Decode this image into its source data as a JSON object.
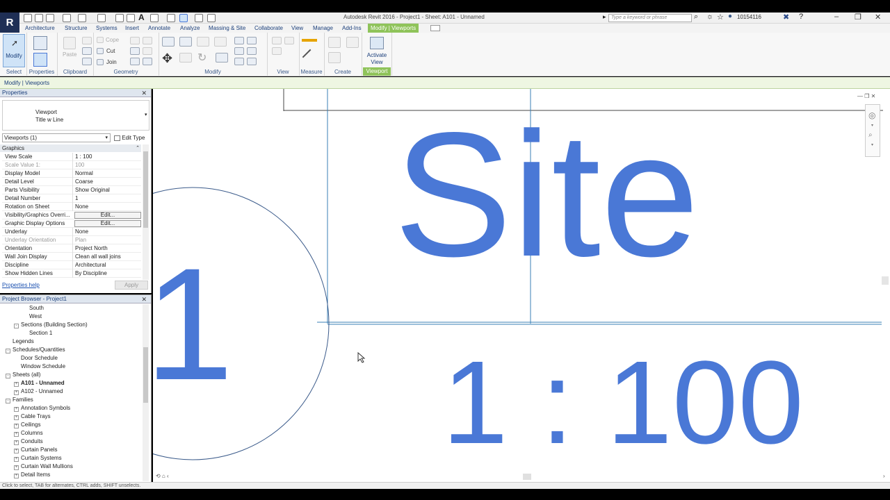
{
  "app": {
    "logo": "R",
    "title": "Autodesk Revit 2016 -    Project1 - Sheet: A101 - Unnamed",
    "search_placeholder": "Type a keyword or phrase",
    "user": "10154116"
  },
  "tabs": [
    "Architecture",
    "Structure",
    "Systems",
    "Insert",
    "Annotate",
    "Analyze",
    "Massing & Site",
    "Collaborate",
    "View",
    "Manage",
    "Add-Ins",
    "Modify | Viewports"
  ],
  "ribbon": {
    "modify_label": "Modify",
    "select_label": "Select",
    "properties_label": "Properties",
    "clipboard_label": "Clipboard",
    "paste_label": "Paste",
    "cope_label": "Cope",
    "cut_label": "Cut",
    "join_label": "Join",
    "geometry_label": "Geometry",
    "modify_panel_label": "Modify",
    "view_label": "View",
    "measure_label": "Measure",
    "create_label": "Create",
    "activate_view_label": "Activate View",
    "viewport_label": "Viewport"
  },
  "context_bar": "Modify | Viewports",
  "properties": {
    "title": "Properties",
    "type_name": "Viewport",
    "type_sub": "Title w Line",
    "selector": "Viewports (1)",
    "edit_type": "Edit Type",
    "section": "Graphics",
    "rows": [
      {
        "k": "View Scale",
        "v": "1 : 100"
      },
      {
        "k": "Scale Value    1:",
        "v": "100"
      },
      {
        "k": "Display Model",
        "v": "Normal"
      },
      {
        "k": "Detail Level",
        "v": "Coarse"
      },
      {
        "k": "Parts Visibility",
        "v": "Show Original"
      },
      {
        "k": "Detail Number",
        "v": "1"
      },
      {
        "k": "Rotation on Sheet",
        "v": "None"
      },
      {
        "k": "Visibility/Graphics Overri...",
        "v": "Edit..."
      },
      {
        "k": "Graphic Display Options",
        "v": "Edit..."
      },
      {
        "k": "Underlay",
        "v": "None"
      },
      {
        "k": "Underlay Orientation",
        "v": "Plan"
      },
      {
        "k": "Orientation",
        "v": "Project North"
      },
      {
        "k": "Wall Join Display",
        "v": "Clean all wall joins"
      },
      {
        "k": "Discipline",
        "v": "Architectural"
      },
      {
        "k": "Show Hidden Lines",
        "v": "By Discipline"
      }
    ],
    "help": "Properties help",
    "apply": "Apply"
  },
  "browser": {
    "title": "Project Browser - Project1",
    "items": [
      {
        "label": "South",
        "indent": 3,
        "toggle": ""
      },
      {
        "label": "West",
        "indent": 3,
        "toggle": ""
      },
      {
        "label": "Sections (Building Section)",
        "indent": 2,
        "toggle": "-"
      },
      {
        "label": "Section 1",
        "indent": 3,
        "toggle": ""
      },
      {
        "label": "Legends",
        "indent": 1,
        "toggle": ""
      },
      {
        "label": "Schedules/Quantities",
        "indent": 1,
        "toggle": "-"
      },
      {
        "label": "Door Schedule",
        "indent": 2,
        "toggle": ""
      },
      {
        "label": "Window Schedule",
        "indent": 2,
        "toggle": ""
      },
      {
        "label": "Sheets (all)",
        "indent": 1,
        "toggle": "-"
      },
      {
        "label": "A101 - Unnamed",
        "indent": 2,
        "toggle": "+"
      },
      {
        "label": "A102 - Unnamed",
        "indent": 2,
        "toggle": "+"
      },
      {
        "label": "Families",
        "indent": 1,
        "toggle": "-"
      },
      {
        "label": "Annotation Symbols",
        "indent": 2,
        "toggle": "+"
      },
      {
        "label": "Cable Trays",
        "indent": 2,
        "toggle": "+"
      },
      {
        "label": "Ceilings",
        "indent": 2,
        "toggle": "+"
      },
      {
        "label": "Columns",
        "indent": 2,
        "toggle": "+"
      },
      {
        "label": "Conduits",
        "indent": 2,
        "toggle": "+"
      },
      {
        "label": "Curtain Panels",
        "indent": 2,
        "toggle": "+"
      },
      {
        "label": "Curtain Systems",
        "indent": 2,
        "toggle": "+"
      },
      {
        "label": "Curtain Wall Mullions",
        "indent": 2,
        "toggle": "+"
      },
      {
        "label": "Detail Items",
        "indent": 2,
        "toggle": "+"
      }
    ]
  },
  "canvas": {
    "view_title": "Site",
    "detail_number": "1",
    "scale": "1 : 100",
    "accent": "#4a78d6"
  },
  "status_text": "Click to select, TAB for alternates, CTRL adds, SHIFT unselects."
}
